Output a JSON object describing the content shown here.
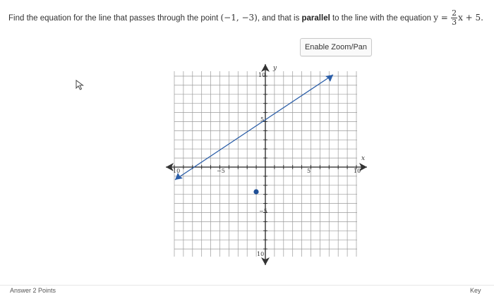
{
  "question": {
    "prefix": "Find the equation for the line that passes through the point ",
    "point": "(−1, −3)",
    "middle": ", and that is ",
    "bold_word": "parallel",
    "after_bold": " to the line with the equation ",
    "equation_lhs": "y =",
    "slope_numerator": "2",
    "slope_denominator": "3",
    "equation_rhs": "x + 5."
  },
  "toolbar": {
    "zoom_label": "Enable Zoom/Pan"
  },
  "graph": {
    "x_axis_label": "x",
    "y_axis_label": "y",
    "tick_labels": {
      "x_neg10": "10",
      "x_neg5": "−5",
      "x_5": "5",
      "x_10": "10",
      "y_10": "10",
      "y_5": "5",
      "y_neg5": "−5",
      "y_neg10": "10"
    },
    "line_color": "#2b5ea8",
    "point_color": "#1f4f96"
  },
  "footer": {
    "left_text": "Answer   2 Points",
    "right_text": "Key"
  }
}
